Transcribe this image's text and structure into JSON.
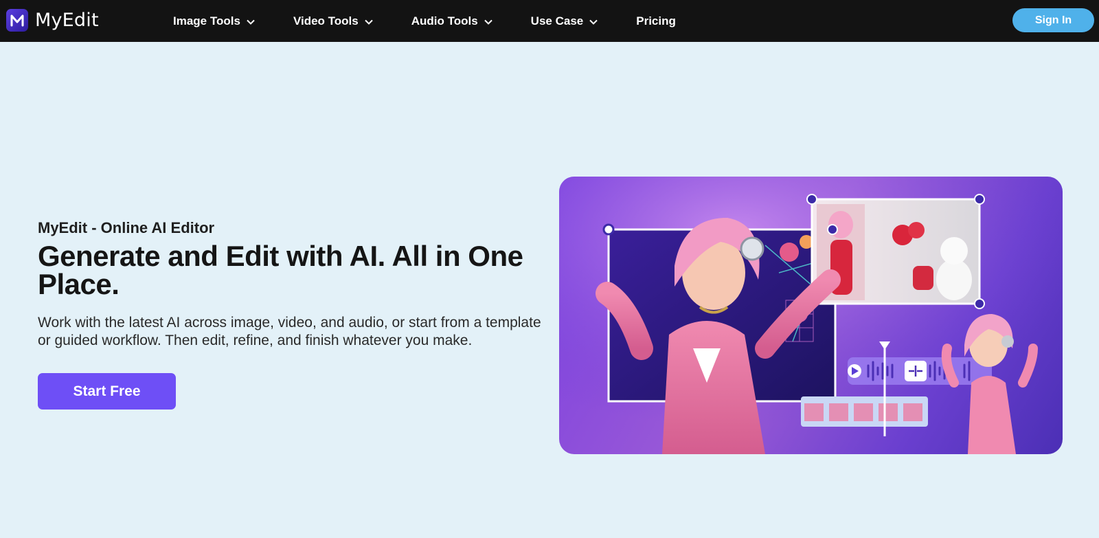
{
  "brand": {
    "name": "MyEdit",
    "logo_letter_icon": "myedit-logo-icon"
  },
  "nav": {
    "items": [
      {
        "label": "Image Tools",
        "has_dropdown": true
      },
      {
        "label": "Video Tools",
        "has_dropdown": true
      },
      {
        "label": "Audio Tools",
        "has_dropdown": true
      },
      {
        "label": "Use Case",
        "has_dropdown": true
      },
      {
        "label": "Pricing",
        "has_dropdown": false
      }
    ],
    "signin_label": "Sign In"
  },
  "hero": {
    "eyebrow": "MyEdit - Online AI Editor",
    "headline": "Generate and Edit with AI. All in One Place.",
    "subcopy": "Work with the latest AI across image, video, and audio, or start from a template or guided workflow. Then edit, refine, and finish whatever you make.",
    "cta_label": "Start Free"
  },
  "colors": {
    "nav_bg": "#131313",
    "page_bg": "#e3f1f8",
    "signin_bg": "#4fb1ea",
    "cta_bg": "#6e4ff6",
    "art_purple": "#7b3fe0"
  }
}
